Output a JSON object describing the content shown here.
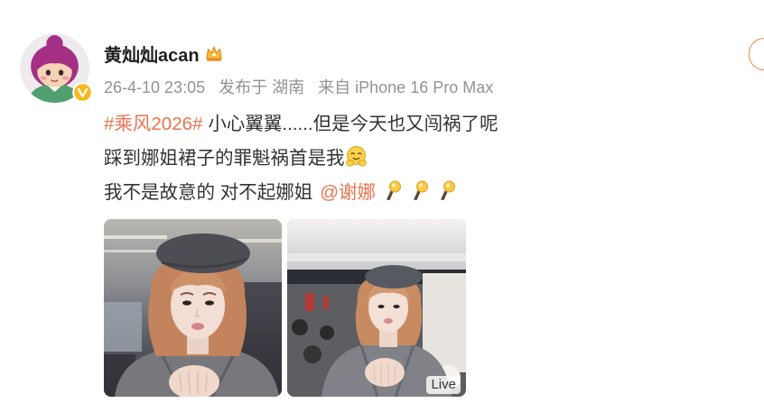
{
  "colors": {
    "accent": "#eb7350",
    "text": "#333333",
    "username": "#1f1f1f",
    "meta": "#939393",
    "follow_border": "#f2873c",
    "verified_badge": "#f5b81f"
  },
  "user": {
    "avatar_icon": "cartoon-girl-avatar",
    "verified_icon": "gold-verified-v-icon",
    "name": "黄灿灿acan",
    "member_icon": "crown-icon"
  },
  "meta": {
    "time": "26-4-10 23:05",
    "location": "发布于 湖南",
    "source": "来自 iPhone 16 Pro Max"
  },
  "post": {
    "line1": {
      "hashtag": "#乘风2026#",
      "text": "小心翼翼......但是今天也又闯祸了呢"
    },
    "line2": {
      "text": "踩到娜姐裙子的罪魁祸首是我",
      "emoji_icon": "hug-emoji-icon"
    },
    "line3": {
      "text": "我不是故意的 对不起娜姐",
      "mention": "@谢娜",
      "emoji_icons": [
        "torch-emoji-icon",
        "torch-emoji-icon",
        "torch-emoji-icon"
      ]
    }
  },
  "photos": {
    "live_badge": "Live"
  }
}
